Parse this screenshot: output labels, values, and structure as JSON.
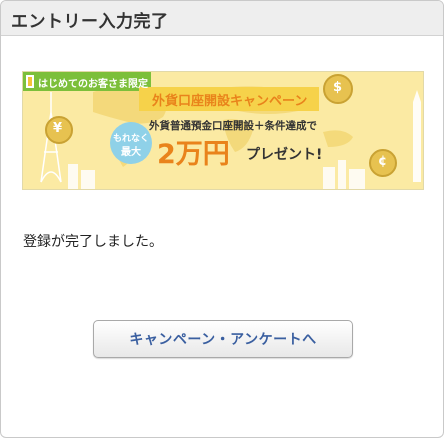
{
  "header": {
    "title": "エントリー入力完了"
  },
  "banner": {
    "tag": "はじめてのお客さま限定",
    "headline": "外貨口座開設キャンペーン",
    "subline": "外貨普通預金口座開設＋条件達成で",
    "badge_line1": "もれなく",
    "badge_line2": "最大",
    "amount": "2万円",
    "suffix": "プレゼント!",
    "coin_yen": "¥",
    "coin_dollar": "$",
    "coin_cent": "¢",
    "colors": {
      "gold": "#f6d24a",
      "blue": "#2f6fb3",
      "orange": "#e9831b",
      "green": "#7cbf3a"
    }
  },
  "message": "登録が完了しました。",
  "cta": {
    "label": "キャンペーン・アンケートへ"
  }
}
